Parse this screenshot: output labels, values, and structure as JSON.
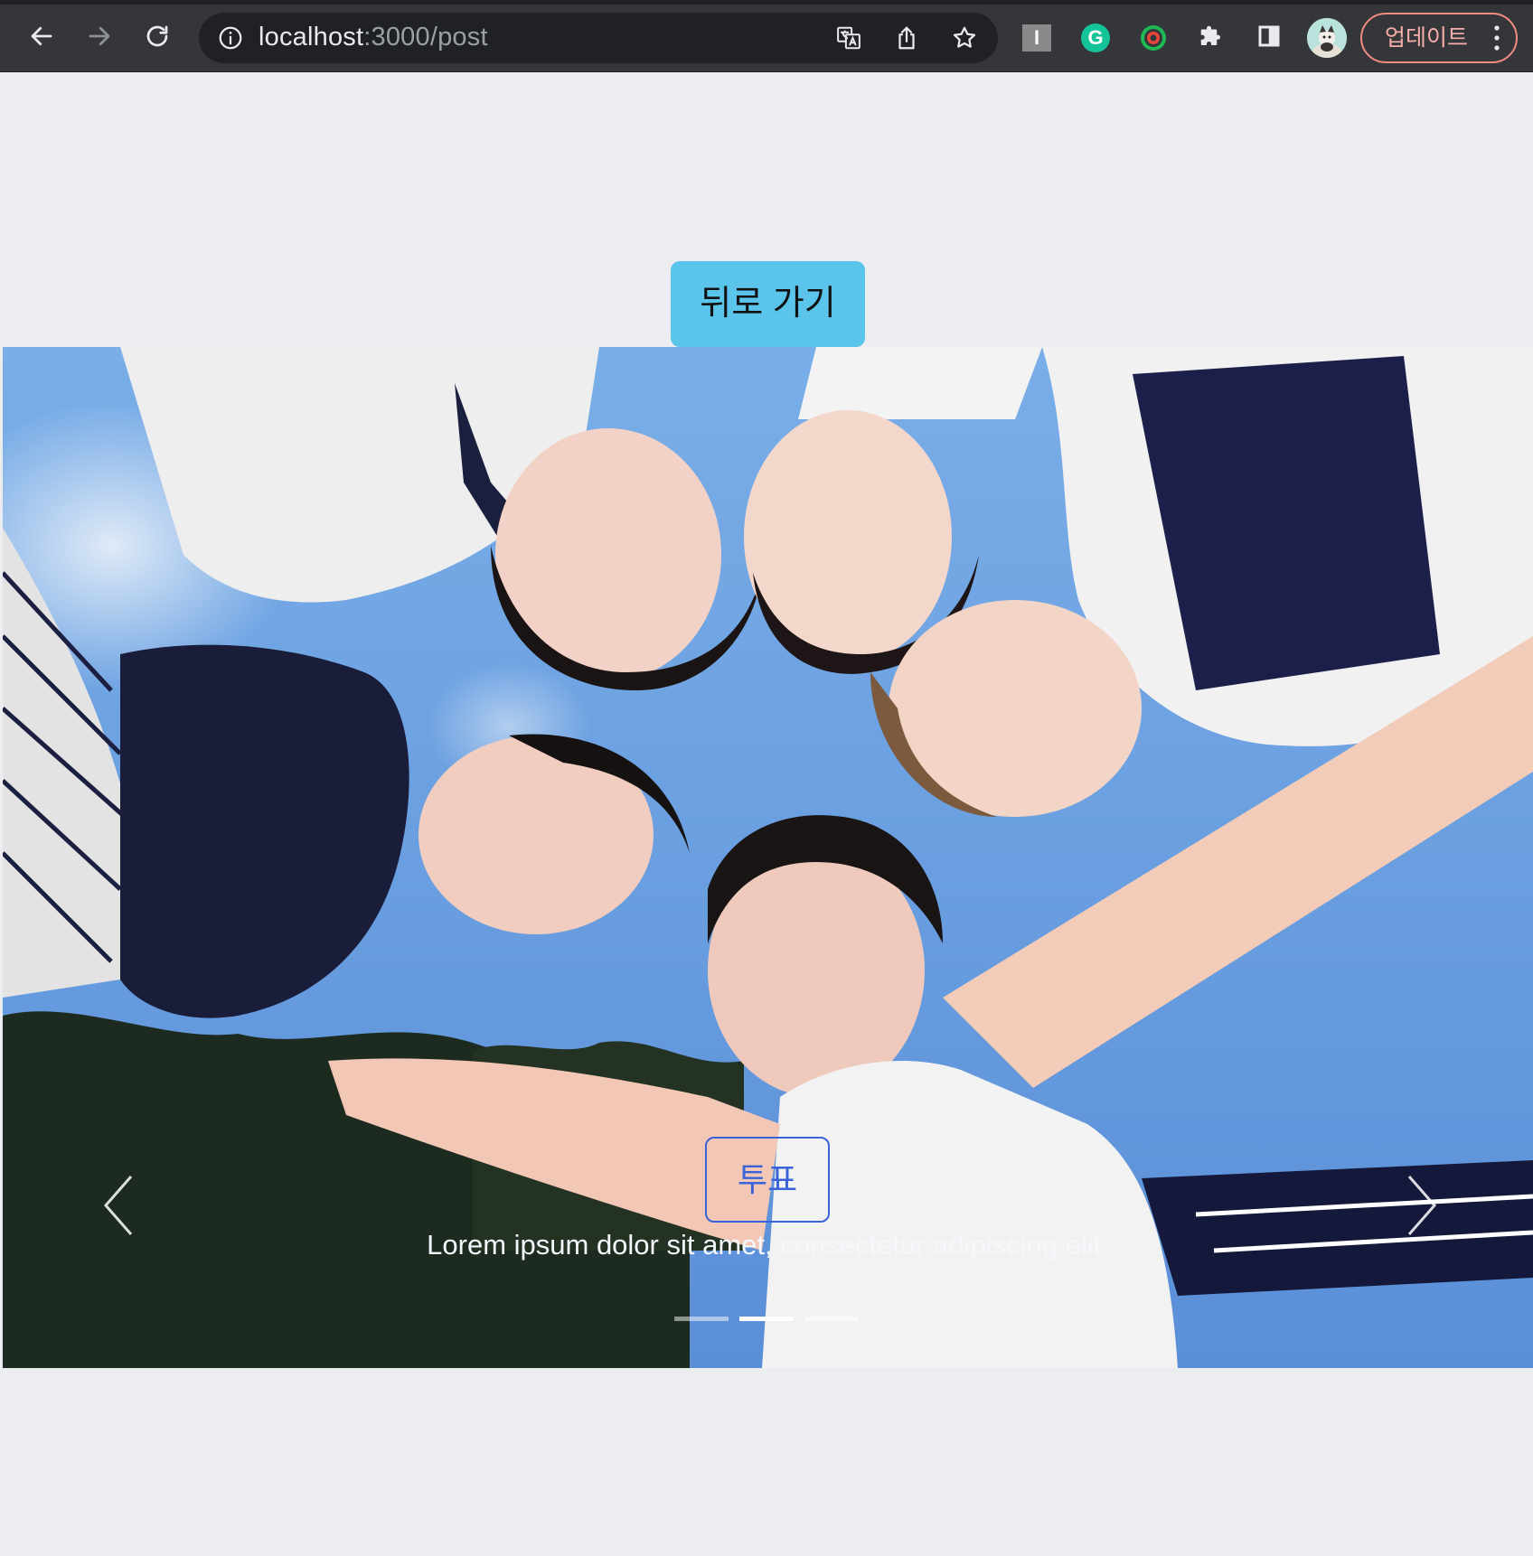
{
  "browser": {
    "url_host": "localhost",
    "url_path": ":3000/post",
    "update_label": "업데이트",
    "extension_i_label": "I",
    "extension_g_label": "G"
  },
  "page": {
    "back_button_label": "뒤로 가기",
    "carousel": {
      "vote_button_label": "투표",
      "caption": "Lorem ipsum dolor sit amet, consectetur adipiscing elit.",
      "slide_count": 3,
      "active_slide": 2
    }
  },
  "colors": {
    "back_button_bg": "#5ac4ea",
    "vote_button_border": "#3b63d8",
    "page_bg": "#ebedf1",
    "update_button_border": "#f28b82"
  }
}
